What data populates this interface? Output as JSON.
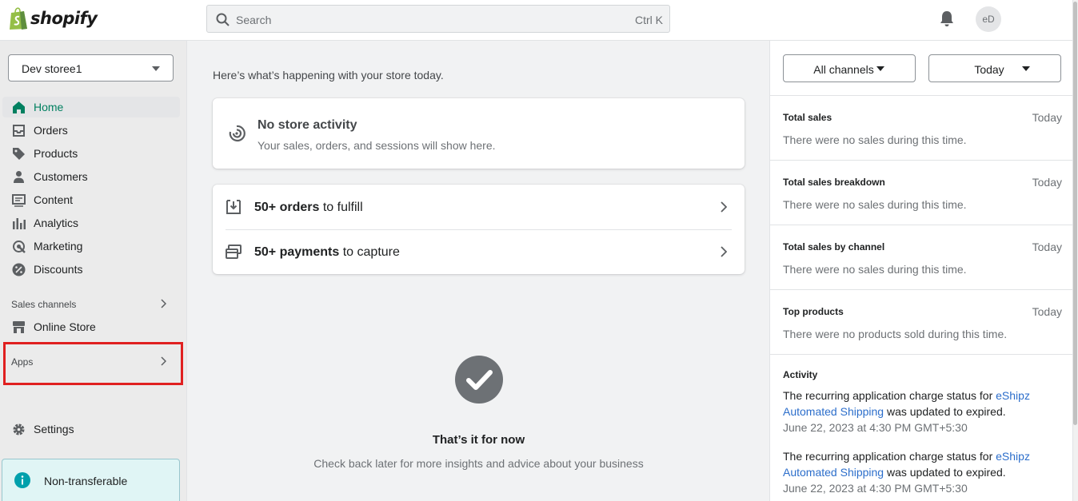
{
  "topbar": {
    "brand": "shopify",
    "search_placeholder": "Search",
    "search_shortcut": "Ctrl K",
    "avatar_initials": "eD"
  },
  "sidebar": {
    "store_name": "Dev storee1",
    "nav": [
      {
        "label": "Home",
        "icon": "home-icon",
        "active": true
      },
      {
        "label": "Orders",
        "icon": "orders-icon"
      },
      {
        "label": "Products",
        "icon": "tag-icon"
      },
      {
        "label": "Customers",
        "icon": "person-icon"
      },
      {
        "label": "Content",
        "icon": "content-icon"
      },
      {
        "label": "Analytics",
        "icon": "bar-chart-icon"
      },
      {
        "label": "Marketing",
        "icon": "target-icon"
      },
      {
        "label": "Discounts",
        "icon": "discount-icon"
      }
    ],
    "sales_channels_label": "Sales channels",
    "online_store_label": "Online Store",
    "apps_label": "Apps",
    "settings_label": "Settings",
    "notice_text": "Non-transferable"
  },
  "main": {
    "greeting": "Here’s what’s happening with your store today.",
    "no_activity_title": "No store activity",
    "no_activity_text": "Your sales, orders, and sessions will show here.",
    "tasks": [
      {
        "bold": "50+ orders",
        "rest": " to fulfill"
      },
      {
        "bold": "50+ payments",
        "rest": " to capture"
      }
    ],
    "done_title": "That’s it for now",
    "done_text": "Check back later for more insights and advice about your business"
  },
  "right": {
    "channels_btn": "All channels",
    "period_btn": "Today",
    "sections": [
      {
        "title": "Total sales",
        "when": "Today",
        "msg": "There were no sales during this time."
      },
      {
        "title": "Total sales breakdown",
        "when": "Today",
        "msg": "There were no sales during this time."
      },
      {
        "title": "Total sales by channel",
        "when": "Today",
        "msg": "There were no sales during this time."
      },
      {
        "title": "Top products",
        "when": "Today",
        "msg": "There were no products sold during this time."
      }
    ],
    "activity_title": "Activity",
    "activity": [
      {
        "prefix": "The recurring application charge status for ",
        "link": "eShipz Automated Shipping",
        "suffix": " was updated to expired.",
        "date": "June 22, 2023 at 4:30 PM GMT+5:30"
      },
      {
        "prefix": "The recurring application charge status for ",
        "link": "eShipz Automated Shipping",
        "suffix": " was updated to expired.",
        "date": "June 22, 2023 at 4:30 PM GMT+5:30"
      }
    ]
  },
  "colors": {
    "brand_green": "#008060",
    "highlight_red": "#e02020",
    "link_blue": "#2c6ecb"
  }
}
